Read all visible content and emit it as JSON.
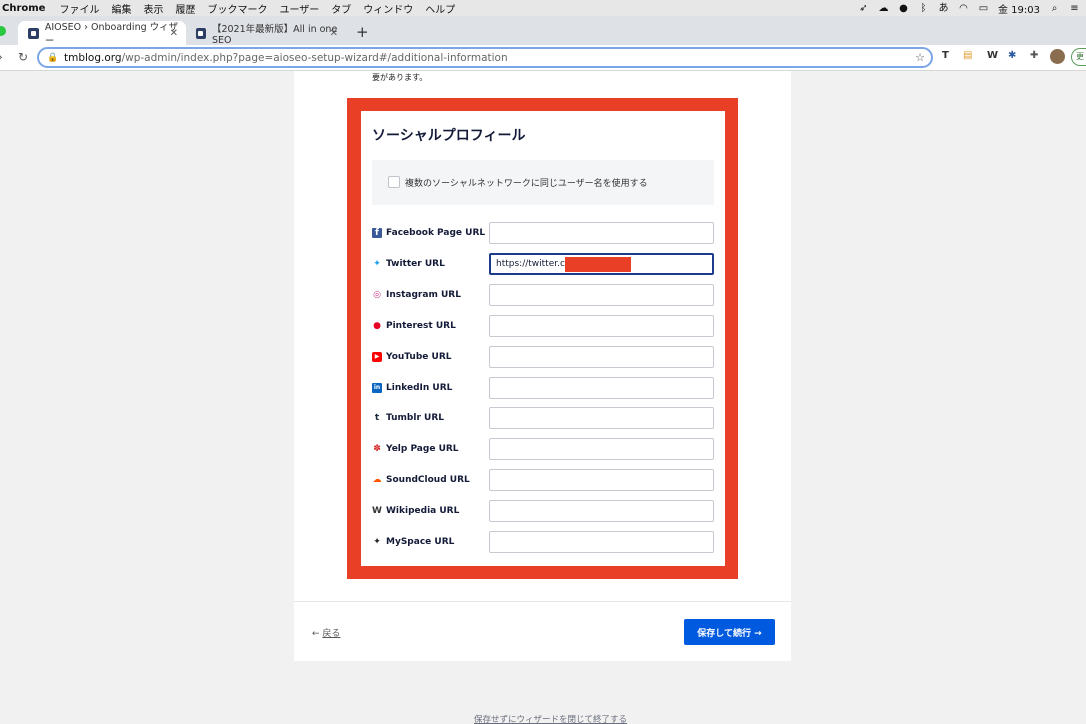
{
  "menubar": {
    "app": "Chrome",
    "items": [
      "ファイル",
      "編集",
      "表示",
      "履歴",
      "ブックマーク",
      "ユーザー",
      "タブ",
      "ウィンドウ",
      "ヘルプ"
    ],
    "clock": "金 19:03"
  },
  "tabs": [
    {
      "title": "AIOSEO › Onboarding ウィザー",
      "close": "✕"
    },
    {
      "title": "【2021年最新版】All in one SEO",
      "close": "✕"
    }
  ],
  "newtab": "+",
  "address": {
    "host": "tmblog.org",
    "path": "/wp-admin/index.php?page=aioseo-setup-wizard#/additional-information"
  },
  "update_button": "更",
  "page": {
    "top_note": "要があります。",
    "section_title": "ソーシャルプロフィール",
    "same_username_label": "複数のソーシャルネットワークに同じユーザー名を使用する",
    "rows": [
      {
        "label": "Facebook Page URL",
        "value": "",
        "icon": "facebook-icon",
        "color": "#3b5998"
      },
      {
        "label": "Twitter URL",
        "value": "https://twitter.com",
        "icon": "twitter-icon",
        "color": "#1da1f2"
      },
      {
        "label": "Instagram URL",
        "value": "",
        "icon": "instagram-icon",
        "color": "#c13584"
      },
      {
        "label": "Pinterest URL",
        "value": "",
        "icon": "pinterest-icon",
        "color": "#e60023"
      },
      {
        "label": "YouTube URL",
        "value": "",
        "icon": "youtube-icon",
        "color": "#ff0000"
      },
      {
        "label": "LinkedIn URL",
        "value": "",
        "icon": "linkedin-icon",
        "color": "#0a66c2"
      },
      {
        "label": "Tumblr URL",
        "value": "",
        "icon": "tumblr-icon",
        "color": "#1b2a3b"
      },
      {
        "label": "Yelp Page URL",
        "value": "",
        "icon": "yelp-icon",
        "color": "#d32323"
      },
      {
        "label": "SoundCloud URL",
        "value": "",
        "icon": "soundcloud-icon",
        "color": "#ff5500"
      },
      {
        "label": "Wikipedia URL",
        "value": "",
        "icon": "wikipedia-icon",
        "color": "#333333"
      },
      {
        "label": "MySpace URL",
        "value": "",
        "icon": "myspace-icon",
        "color": "#222222"
      }
    ],
    "back_label": "戻る",
    "save_label": "保存して続行 →",
    "exit_label": "保存せずにウィザードを閉じて終了する"
  },
  "colors": {
    "accent": "#005ae0",
    "highlight_frame": "#ea3f27"
  }
}
